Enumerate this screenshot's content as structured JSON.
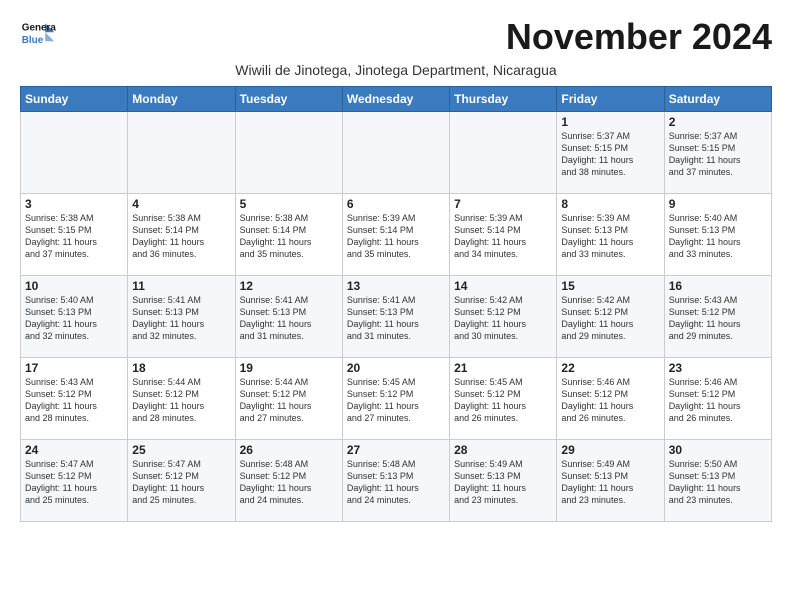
{
  "header": {
    "logo_line1": "General",
    "logo_line2": "Blue",
    "month_title": "November 2024",
    "subtitle": "Wiwili de Jinotega, Jinotega Department, Nicaragua"
  },
  "weekdays": [
    "Sunday",
    "Monday",
    "Tuesday",
    "Wednesday",
    "Thursday",
    "Friday",
    "Saturday"
  ],
  "weeks": [
    [
      {
        "day": "",
        "info": ""
      },
      {
        "day": "",
        "info": ""
      },
      {
        "day": "",
        "info": ""
      },
      {
        "day": "",
        "info": ""
      },
      {
        "day": "",
        "info": ""
      },
      {
        "day": "1",
        "info": "Sunrise: 5:37 AM\nSunset: 5:15 PM\nDaylight: 11 hours\nand 38 minutes."
      },
      {
        "day": "2",
        "info": "Sunrise: 5:37 AM\nSunset: 5:15 PM\nDaylight: 11 hours\nand 37 minutes."
      }
    ],
    [
      {
        "day": "3",
        "info": "Sunrise: 5:38 AM\nSunset: 5:15 PM\nDaylight: 11 hours\nand 37 minutes."
      },
      {
        "day": "4",
        "info": "Sunrise: 5:38 AM\nSunset: 5:14 PM\nDaylight: 11 hours\nand 36 minutes."
      },
      {
        "day": "5",
        "info": "Sunrise: 5:38 AM\nSunset: 5:14 PM\nDaylight: 11 hours\nand 35 minutes."
      },
      {
        "day": "6",
        "info": "Sunrise: 5:39 AM\nSunset: 5:14 PM\nDaylight: 11 hours\nand 35 minutes."
      },
      {
        "day": "7",
        "info": "Sunrise: 5:39 AM\nSunset: 5:14 PM\nDaylight: 11 hours\nand 34 minutes."
      },
      {
        "day": "8",
        "info": "Sunrise: 5:39 AM\nSunset: 5:13 PM\nDaylight: 11 hours\nand 33 minutes."
      },
      {
        "day": "9",
        "info": "Sunrise: 5:40 AM\nSunset: 5:13 PM\nDaylight: 11 hours\nand 33 minutes."
      }
    ],
    [
      {
        "day": "10",
        "info": "Sunrise: 5:40 AM\nSunset: 5:13 PM\nDaylight: 11 hours\nand 32 minutes."
      },
      {
        "day": "11",
        "info": "Sunrise: 5:41 AM\nSunset: 5:13 PM\nDaylight: 11 hours\nand 32 minutes."
      },
      {
        "day": "12",
        "info": "Sunrise: 5:41 AM\nSunset: 5:13 PM\nDaylight: 11 hours\nand 31 minutes."
      },
      {
        "day": "13",
        "info": "Sunrise: 5:41 AM\nSunset: 5:13 PM\nDaylight: 11 hours\nand 31 minutes."
      },
      {
        "day": "14",
        "info": "Sunrise: 5:42 AM\nSunset: 5:12 PM\nDaylight: 11 hours\nand 30 minutes."
      },
      {
        "day": "15",
        "info": "Sunrise: 5:42 AM\nSunset: 5:12 PM\nDaylight: 11 hours\nand 29 minutes."
      },
      {
        "day": "16",
        "info": "Sunrise: 5:43 AM\nSunset: 5:12 PM\nDaylight: 11 hours\nand 29 minutes."
      }
    ],
    [
      {
        "day": "17",
        "info": "Sunrise: 5:43 AM\nSunset: 5:12 PM\nDaylight: 11 hours\nand 28 minutes."
      },
      {
        "day": "18",
        "info": "Sunrise: 5:44 AM\nSunset: 5:12 PM\nDaylight: 11 hours\nand 28 minutes."
      },
      {
        "day": "19",
        "info": "Sunrise: 5:44 AM\nSunset: 5:12 PM\nDaylight: 11 hours\nand 27 minutes."
      },
      {
        "day": "20",
        "info": "Sunrise: 5:45 AM\nSunset: 5:12 PM\nDaylight: 11 hours\nand 27 minutes."
      },
      {
        "day": "21",
        "info": "Sunrise: 5:45 AM\nSunset: 5:12 PM\nDaylight: 11 hours\nand 26 minutes."
      },
      {
        "day": "22",
        "info": "Sunrise: 5:46 AM\nSunset: 5:12 PM\nDaylight: 11 hours\nand 26 minutes."
      },
      {
        "day": "23",
        "info": "Sunrise: 5:46 AM\nSunset: 5:12 PM\nDaylight: 11 hours\nand 26 minutes."
      }
    ],
    [
      {
        "day": "24",
        "info": "Sunrise: 5:47 AM\nSunset: 5:12 PM\nDaylight: 11 hours\nand 25 minutes."
      },
      {
        "day": "25",
        "info": "Sunrise: 5:47 AM\nSunset: 5:12 PM\nDaylight: 11 hours\nand 25 minutes."
      },
      {
        "day": "26",
        "info": "Sunrise: 5:48 AM\nSunset: 5:12 PM\nDaylight: 11 hours\nand 24 minutes."
      },
      {
        "day": "27",
        "info": "Sunrise: 5:48 AM\nSunset: 5:13 PM\nDaylight: 11 hours\nand 24 minutes."
      },
      {
        "day": "28",
        "info": "Sunrise: 5:49 AM\nSunset: 5:13 PM\nDaylight: 11 hours\nand 23 minutes."
      },
      {
        "day": "29",
        "info": "Sunrise: 5:49 AM\nSunset: 5:13 PM\nDaylight: 11 hours\nand 23 minutes."
      },
      {
        "day": "30",
        "info": "Sunrise: 5:50 AM\nSunset: 5:13 PM\nDaylight: 11 hours\nand 23 minutes."
      }
    ]
  ]
}
